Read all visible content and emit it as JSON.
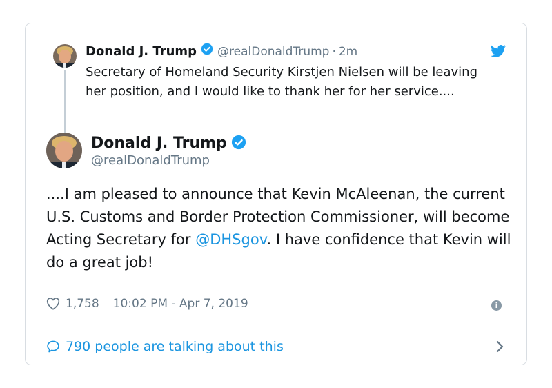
{
  "parent_tweet": {
    "name": "Donald J. Trump",
    "handle": "@realDonaldTrump",
    "separator": "·",
    "time": "2m",
    "text": "Secretary of Homeland Security Kirstjen Nielsen will be leaving her position, and I would like to thank her for her service...."
  },
  "main_tweet": {
    "name": "Donald J. Trump",
    "handle": "@realDonaldTrump",
    "text_before_mention": "....I am pleased to announce that Kevin McAleenan, the current U.S. Customs and Border Protection Commissioner, will become Acting Secretary for ",
    "mention": "@DHSgov",
    "text_after_mention": ". I have confidence that Kevin will do a great job!",
    "likes": "1,758",
    "timestamp": "10:02 PM - Apr 7, 2019"
  },
  "footer": {
    "label": "790 people are talking about this"
  },
  "info_glyph": "i",
  "colors": {
    "accent": "#1b95e0",
    "muted": "#657786",
    "text": "#14171a",
    "verified": "#1da1f2"
  },
  "icons": [
    "verified-badge-icon",
    "twitter-bird-icon",
    "heart-icon",
    "info-icon",
    "speech-bubble-icon",
    "chevron-right-icon"
  ]
}
